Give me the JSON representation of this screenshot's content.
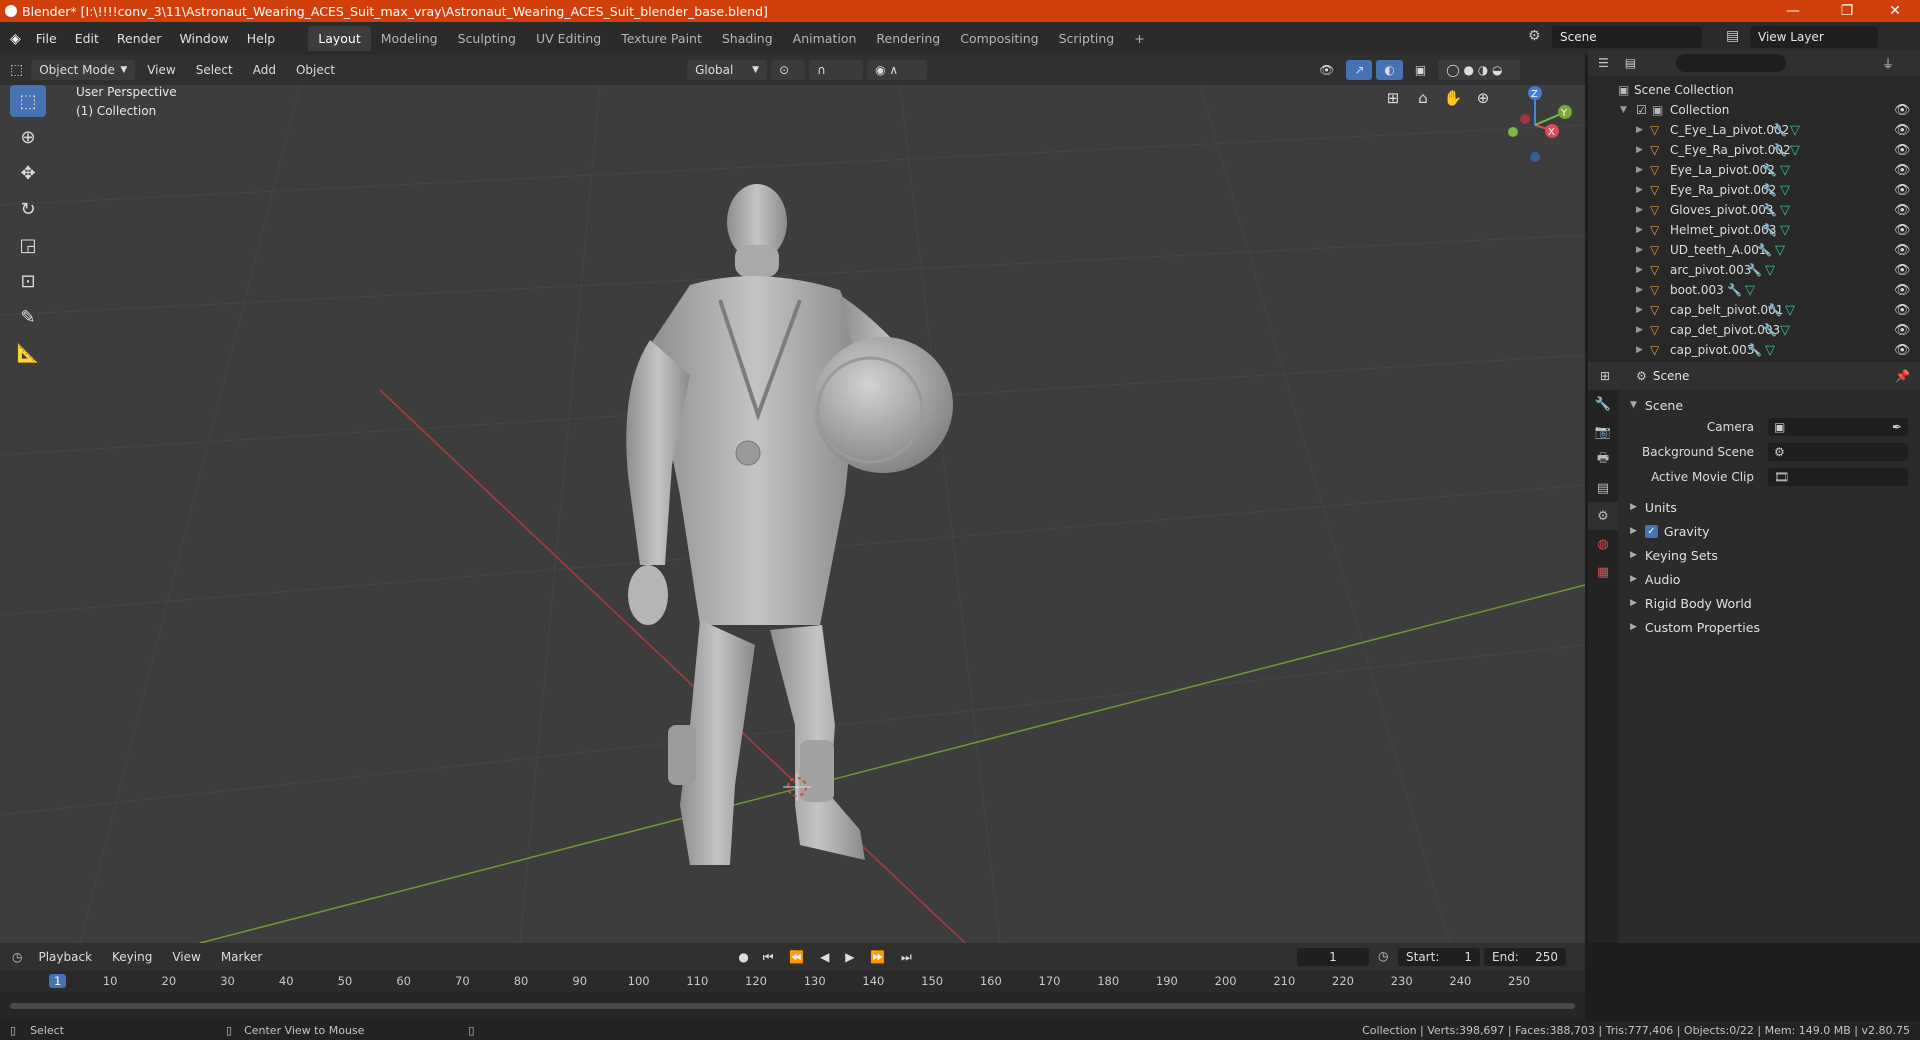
{
  "window": {
    "title": "Blender* [I:\\!!!!conv_3\\11\\Astronaut_Wearing_ACES_Suit_max_vray\\Astronaut_Wearing_ACES_Suit_blender_base.blend]",
    "minimize": "—",
    "maximize": "❐",
    "close": "✕"
  },
  "menu": [
    "File",
    "Edit",
    "Render",
    "Window",
    "Help"
  ],
  "workspaces": [
    "Layout",
    "Modeling",
    "Sculpting",
    "UV Editing",
    "Texture Paint",
    "Shading",
    "Animation",
    "Rendering",
    "Compositing",
    "Scripting"
  ],
  "add_workspace": "+",
  "scene_name": "Scene",
  "view_layer": "View Layer",
  "viewport_header": {
    "mode": "Object Mode",
    "menus": [
      "View",
      "Select",
      "Add",
      "Object"
    ],
    "orientation": "Global"
  },
  "viewport": {
    "perspective": "User Perspective",
    "collection": "(1) Collection",
    "gizmo_x": "X",
    "gizmo_y": "Y",
    "gizmo_z": "Z"
  },
  "outliner": {
    "root": "Scene Collection",
    "collection": "Collection",
    "items": [
      "C_Eye_La_pivot.002",
      "C_Eye_Ra_pivot.002",
      "Eye_La_pivot.002",
      "Eye_Ra_pivot.002",
      "Gloves_pivot.003",
      "Helmet_pivot.003",
      "UD_teeth_A.001",
      "arc_pivot.003",
      "boot.003",
      "cap_belt_pivot.001",
      "cap_det_pivot.003",
      "cap_pivot.003"
    ]
  },
  "properties": {
    "header": "Scene",
    "panel": "Scene",
    "camera_label": "Camera",
    "background_label": "Background Scene",
    "movieclip_label": "Active Movie Clip",
    "sections": [
      "Units",
      "Gravity",
      "Keying Sets",
      "Audio",
      "Rigid Body World",
      "Custom Properties"
    ]
  },
  "timeline": {
    "menus": [
      "Playback",
      "Keying",
      "View",
      "Marker"
    ],
    "current_frame": "1",
    "start_label": "Start:",
    "start": "1",
    "end_label": "End:",
    "end": "250",
    "ticks": [
      "1",
      "10",
      "20",
      "30",
      "40",
      "50",
      "60",
      "70",
      "80",
      "90",
      "100",
      "110",
      "120",
      "130",
      "140",
      "150",
      "160",
      "170",
      "180",
      "190",
      "200",
      "210",
      "220",
      "230",
      "240",
      "250"
    ]
  },
  "statusbar": {
    "select": "Select",
    "center": "Center View to Mouse",
    "stats": "Collection | Verts:398,697 | Faces:388,703 | Tris:777,406 | Objects:0/22 | Mem: 149.0 MB | v2.80.75"
  },
  "colors": {
    "titlebar": "#d13f0c",
    "accent": "#4772b3",
    "x_axis": "#b23a3a",
    "y_axis": "#6f9a2e"
  }
}
